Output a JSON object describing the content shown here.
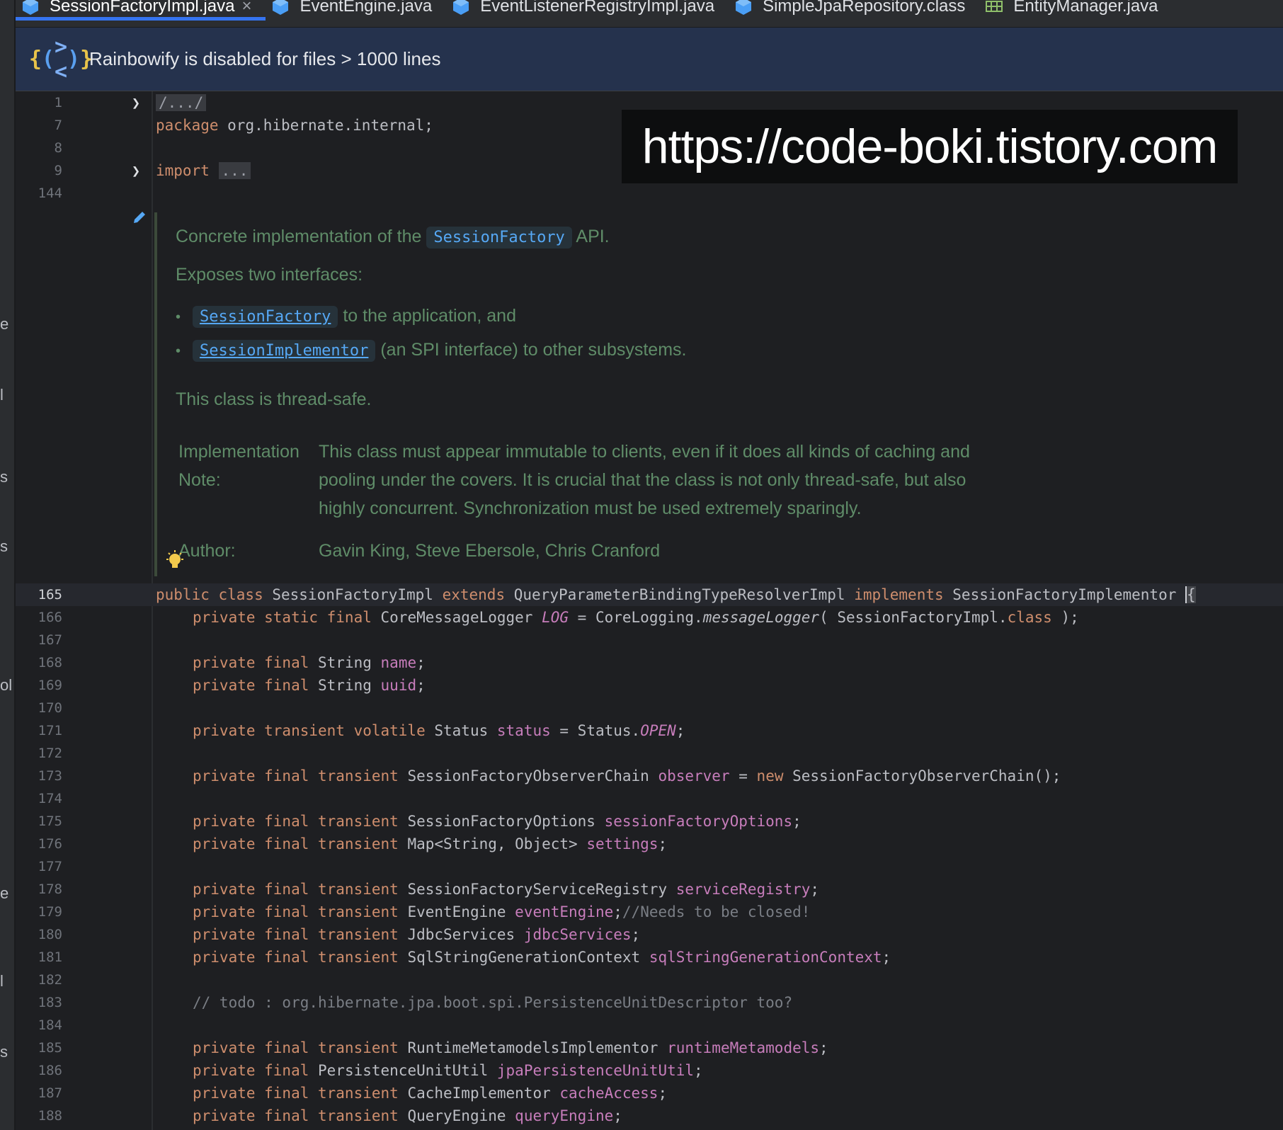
{
  "left_strip": {
    "chars": [
      "e",
      "l",
      "s",
      "s",
      "ol",
      "e",
      "l",
      "s"
    ]
  },
  "tabs": [
    {
      "label": "SessionFactoryImpl.java",
      "active": true,
      "close": "×",
      "icon": "java-class-icon"
    },
    {
      "label": "EventEngine.java",
      "active": false,
      "icon": "java-class-icon"
    },
    {
      "label": "EventListenerRegistryImpl.java",
      "active": false,
      "icon": "java-class-icon"
    },
    {
      "label": "SimpleJpaRepository.class",
      "active": false,
      "icon": "java-class-icon"
    },
    {
      "label": "EntityManager.java",
      "active": false,
      "icon": "interface-icon"
    }
  ],
  "banner": {
    "icon_text": "{(><)}",
    "text": "Rainbowify is disabled for files > 1000 lines"
  },
  "watermark": "https://code-boki.tistory.com",
  "header_lines": {
    "l1": {
      "num": "1",
      "text": "/.../"
    },
    "l7": {
      "num": "7",
      "kw": "package",
      "text": " org.hibernate.internal;"
    },
    "l8": {
      "num": "8"
    },
    "l9": {
      "num": "9",
      "kw": "import",
      "text": "..."
    },
    "l144": {
      "num": "144"
    }
  },
  "doc": {
    "line1_pre": "Concrete implementation of the",
    "line1_code": "SessionFactory",
    "line1_post": "API.",
    "line2": "Exposes two interfaces:",
    "bullet1_code": "SessionFactory",
    "bullet1_text": "to the application, and",
    "bullet2_code": "SessionImplementor",
    "bullet2_text": "(an SPI interface) to other subsystems.",
    "line3": "This class is thread-safe.",
    "impl_label_1": "Implementation",
    "impl_label_2": "Note:",
    "impl_text_1": "This class must appear immutable to clients, even if it does all kinds of caching and",
    "impl_text_2": "pooling under the covers. It is crucial that the class is not only thread-safe, but also",
    "impl_text_3": "highly concurrent. Synchronization must be used extremely sparingly.",
    "author_label": "Author:",
    "author_text": "Gavin King, Steve Ebersole, Chris Cranford"
  },
  "code_lines": [
    {
      "num": "165"
    },
    {
      "num": "166"
    },
    {
      "num": "167"
    },
    {
      "num": "168"
    },
    {
      "num": "169"
    },
    {
      "num": "170"
    },
    {
      "num": "171"
    },
    {
      "num": "172"
    },
    {
      "num": "173"
    },
    {
      "num": "174"
    },
    {
      "num": "175"
    },
    {
      "num": "176"
    },
    {
      "num": "177"
    },
    {
      "num": "178"
    },
    {
      "num": "179"
    },
    {
      "num": "180"
    },
    {
      "num": "181"
    },
    {
      "num": "182"
    },
    {
      "num": "183"
    },
    {
      "num": "184"
    },
    {
      "num": "185"
    },
    {
      "num": "186"
    },
    {
      "num": "187"
    },
    {
      "num": "188"
    }
  ],
  "code": {
    "c165": [
      "public class",
      " SessionFactoryImpl ",
      "extends",
      " QueryParameterBindingTypeResolverImpl ",
      "implements",
      " SessionFactoryImplementor ",
      "{"
    ],
    "c166": [
      "private static final",
      " CoreMessageLogger ",
      "LOG",
      " = CoreLogging.",
      "messageLogger",
      "( SessionFactoryImpl.",
      "class",
      " );"
    ],
    "c168": [
      "private final",
      " String ",
      "name",
      ";"
    ],
    "c169": [
      "private final",
      " String ",
      "uuid",
      ";"
    ],
    "c171": [
      "private transient volatile",
      " Status ",
      "status",
      " = Status.",
      "OPEN",
      ";"
    ],
    "c173": [
      "private final transient",
      " SessionFactoryObserverChain ",
      "observer",
      " = ",
      "new",
      " SessionFactoryObserverChain();"
    ],
    "c175": [
      "private final transient",
      " SessionFactoryOptions ",
      "sessionFactoryOptions",
      ";"
    ],
    "c176": [
      "private final transient",
      " Map<String, Object> ",
      "settings",
      ";"
    ],
    "c178": [
      "private final transient",
      " SessionFactoryServiceRegistry ",
      "serviceRegistry",
      ";"
    ],
    "c179": [
      "private final transient",
      " EventEngine ",
      "eventEngine",
      ";",
      "//Needs to be closed!"
    ],
    "c180": [
      "private final transient",
      " JdbcServices ",
      "jdbcServices",
      ";"
    ],
    "c181": [
      "private final transient",
      " SqlStringGenerationContext ",
      "sqlStringGenerationContext",
      ";"
    ],
    "c183": [
      "// todo : org.hibernate.jpa.boot.spi.PersistenceUnitDescriptor too?"
    ],
    "c185": [
      "private final transient",
      " RuntimeMetamodelsImplementor ",
      "runtimeMetamodels",
      ";"
    ],
    "c186": [
      "private final",
      " PersistenceUnitUtil ",
      "jpaPersistenceUnitUtil",
      ";"
    ],
    "c187": [
      "private final transient",
      " CacheImplementor ",
      "cacheAccess",
      ";"
    ],
    "c188": [
      "private final transient",
      " QueryEngine ",
      "queryEngine",
      ";"
    ]
  },
  "colors": {
    "keyword": "#cf8e6d",
    "field": "#c77dbb",
    "comment": "#7a7e85",
    "doc": "#5f8c68",
    "link": "#56a8f5",
    "accent": "#3574f0"
  }
}
